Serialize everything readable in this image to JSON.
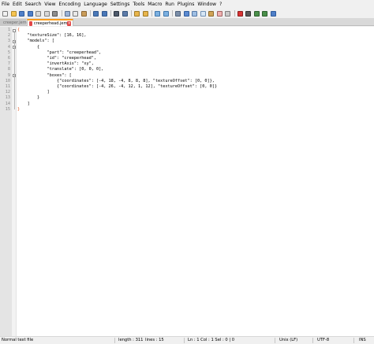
{
  "menu": [
    "File",
    "Edit",
    "Search",
    "View",
    "Encoding",
    "Language",
    "Settings",
    "Tools",
    "Macro",
    "Run",
    "Plugins",
    "Window",
    "?"
  ],
  "toolbar": {
    "buttons": [
      {
        "name": "new-file-icon",
        "color": "#f2f2f2",
        "border": "#7c7c7c"
      },
      {
        "name": "open-file-icon",
        "color": "#f6c451",
        "border": "#b08a2a"
      },
      {
        "name": "save-icon",
        "color": "#4f7fc8",
        "border": "#2e5a9b"
      },
      {
        "name": "save-all-icon",
        "color": "#4f7fc8",
        "border": "#2e5a9b"
      },
      {
        "name": "close-icon",
        "color": "#d8d8d8",
        "border": "#808080"
      },
      {
        "name": "close-all-icon",
        "color": "#d8d8d8",
        "border": "#808080"
      },
      {
        "name": "print-icon",
        "color": "#8d8d8d",
        "border": "#555555"
      },
      {
        "sep": true
      },
      {
        "name": "cut-icon",
        "color": "#9bb3d6",
        "border": "#5b6f91"
      },
      {
        "name": "copy-icon",
        "color": "#e9e9e9",
        "border": "#7b7b7b"
      },
      {
        "name": "paste-icon",
        "color": "#c99c5a",
        "border": "#8a6533"
      },
      {
        "sep": true
      },
      {
        "name": "undo-icon",
        "color": "#4a78b8",
        "border": "#2f578e"
      },
      {
        "name": "redo-icon",
        "color": "#4a78b8",
        "border": "#2f578e"
      },
      {
        "sep": true
      },
      {
        "name": "find-icon",
        "color": "#4e5a6b",
        "border": "#2a3340"
      },
      {
        "name": "replace-icon",
        "color": "#5e7ca8",
        "border": "#34547c"
      },
      {
        "sep": true
      },
      {
        "name": "zoom-in-icon",
        "color": "#e8b54c",
        "border": "#a07a26"
      },
      {
        "name": "zoom-out-icon",
        "color": "#e8b54c",
        "border": "#a07a26"
      },
      {
        "sep": true
      },
      {
        "name": "sync-vertical-icon",
        "color": "#7cb0e0",
        "border": "#3f77ad"
      },
      {
        "name": "sync-horizontal-icon",
        "color": "#7cb0e0",
        "border": "#3f77ad"
      },
      {
        "sep": true
      },
      {
        "name": "word-wrap-icon",
        "color": "#7b8ea8",
        "border": "#4e607a"
      },
      {
        "name": "show-all-chars-icon",
        "color": "#5c8ad0",
        "border": "#2f5e9f"
      },
      {
        "name": "indent-guide-icon",
        "color": "#9fbfe3",
        "border": "#5578a6"
      },
      {
        "name": "user-language-icon",
        "color": "#d6e6f5",
        "border": "#6f8fb3"
      },
      {
        "name": "doc-map-icon",
        "color": "#d0a356",
        "border": "#8d6a2e"
      },
      {
        "name": "function-list-icon",
        "color": "#efb1b1",
        "border": "#a06262"
      },
      {
        "name": "folder-workspace-icon",
        "color": "#c9c9c9",
        "border": "#7e7e7e"
      },
      {
        "sep": true
      },
      {
        "name": "record-macro-icon",
        "color": "#d93434",
        "border": "#8b1c1c"
      },
      {
        "name": "stop-macro-icon",
        "color": "#5a5a5a",
        "border": "#333333"
      },
      {
        "name": "play-macro-icon",
        "color": "#4a8f4a",
        "border": "#2c5e2c"
      },
      {
        "name": "run-macro-multiple-icon",
        "color": "#4a8f4a",
        "border": "#2c5e2c"
      },
      {
        "name": "save-macro-icon",
        "color": "#4f7fc8",
        "border": "#2e5a9b"
      }
    ]
  },
  "tabs": [
    {
      "label": "creeper.jem",
      "icon_color": "#4f7fc8",
      "active": false
    },
    {
      "label": "creeperhead.jem",
      "icon_color": "#e34747",
      "active": true
    }
  ],
  "editor": {
    "line_numbers": [
      "1",
      "2",
      "3",
      "4",
      "5",
      "6",
      "7",
      "8",
      "9",
      "10",
      "11",
      "12",
      "13",
      "14",
      "15"
    ],
    "lines": [
      "{",
      "    \"textureSize\": [16, 16],",
      "    \"models\": [",
      "        {",
      "            \"part\": \"creeperhead\",",
      "            \"id\": \"creeperhead\",",
      "            \"invertAxis\": \"xy\",",
      "            \"translate\": [0, 0, 0],",
      "            \"boxes\": [",
      "                {\"coordinates\": [-4, 18, -4, 8, 8, 8], \"textureOffset\": [0, 0]},",
      "                {\"coordinates\": [-4, 26, -4, 12, 1, 12], \"textureOffset\": [0, 0]}",
      "            ]",
      "        }",
      "    ]",
      "}"
    ]
  },
  "status": {
    "file_type": "Normal text file",
    "length": "length : 311",
    "lines": "lines : 15",
    "position": "Ln : 1    Col : 1    Sel : 0 | 0",
    "eol": "Unix (LF)",
    "encoding": "UTF-8",
    "mode": "INS"
  }
}
